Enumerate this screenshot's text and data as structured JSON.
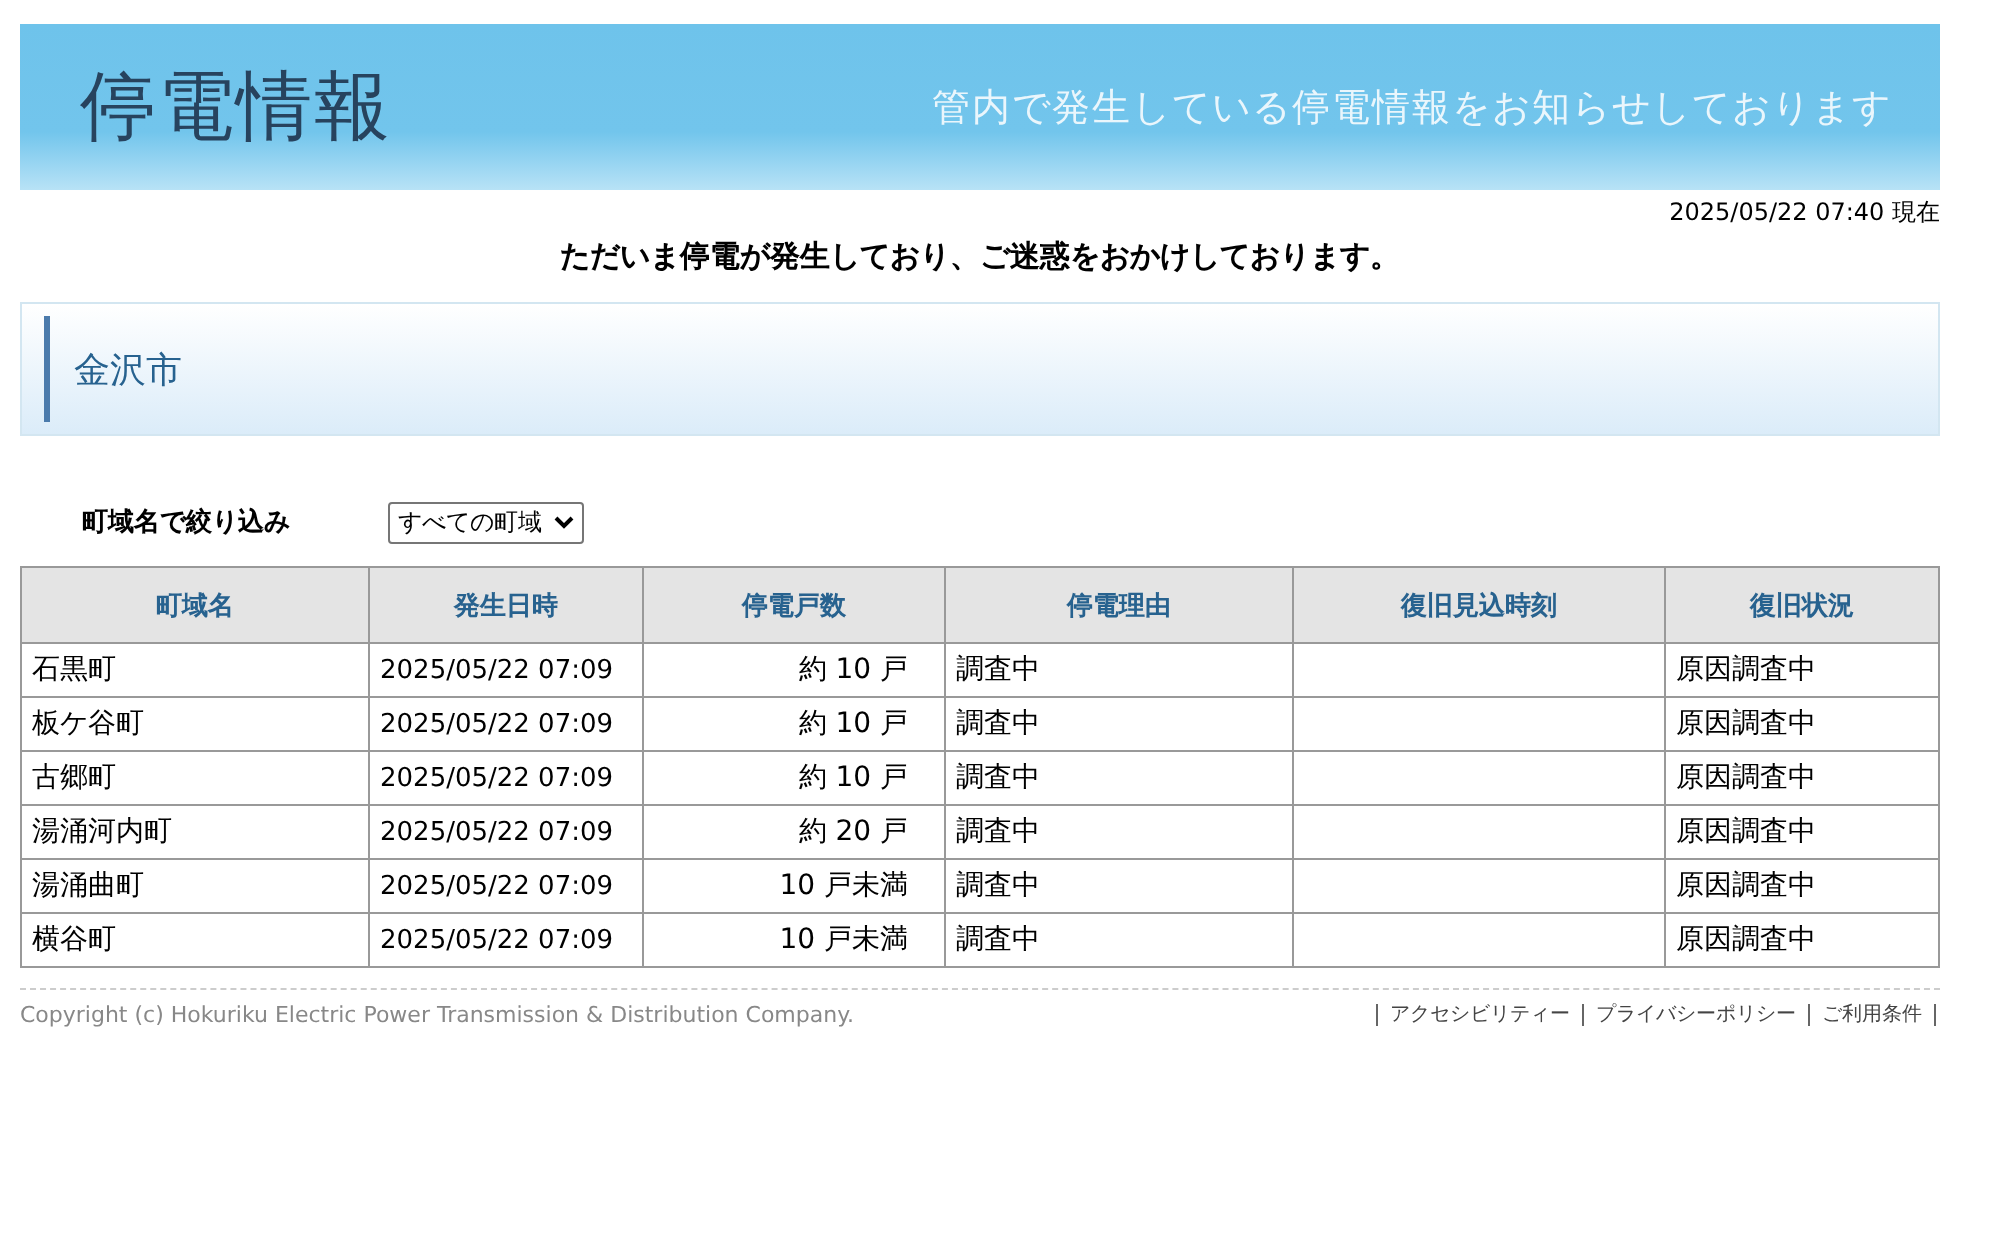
{
  "header": {
    "title": "停電情報",
    "subtitle": "管内で発生している停電情報をお知らせしております"
  },
  "timestamp": "2025/05/22 07:40 現在",
  "notice": "ただいま停電が発生しており、ご迷惑をおかけしております。",
  "area": {
    "title": "金沢市"
  },
  "filter": {
    "label": "町域名で絞り込み",
    "value": "すべての町域"
  },
  "table": {
    "columns": [
      "町域名",
      "発生日時",
      "停電戸数",
      "停電理由",
      "復旧見込時刻",
      "復旧状況"
    ],
    "rows": [
      [
        "石黒町",
        "2025/05/22 07:09",
        "約 10 戸",
        "調査中",
        "",
        "原因調査中"
      ],
      [
        "板ケ谷町",
        "2025/05/22 07:09",
        "約 10 戸",
        "調査中",
        "",
        "原因調査中"
      ],
      [
        "古郷町",
        "2025/05/22 07:09",
        "約 10 戸",
        "調査中",
        "",
        "原因調査中"
      ],
      [
        "湯涌河内町",
        "2025/05/22 07:09",
        "約 20 戸",
        "調査中",
        "",
        "原因調査中"
      ],
      [
        "湯涌曲町",
        "2025/05/22 07:09",
        "10 戸未満",
        "調査中",
        "",
        "原因調査中"
      ],
      [
        "横谷町",
        "2025/05/22 07:09",
        "10 戸未満",
        "調査中",
        "",
        "原因調査中"
      ]
    ]
  },
  "footer": {
    "copyright": "Copyright (c) Hokuriku Electric Power Transmission & Distribution Company.",
    "links": [
      "アクセシビリティー",
      "プライバシーポリシー",
      "ご利用条件"
    ]
  }
}
